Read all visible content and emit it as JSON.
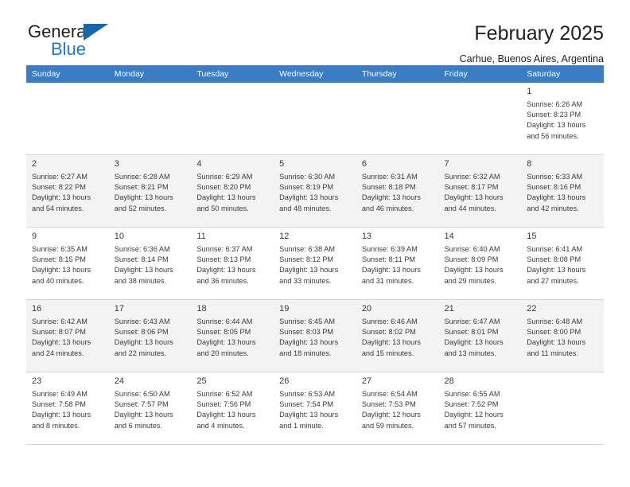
{
  "brand": {
    "name_part1": "General",
    "name_part2": "Blue",
    "triangle_color": "#1567b3",
    "blue_color": "#1f7ac4"
  },
  "header": {
    "title": "February 2025",
    "location": "Carhue, Buenos Aires, Argentina"
  },
  "theme": {
    "header_row_bg": "#3b7dc4",
    "header_row_text": "#ffffff",
    "shaded_row_bg": "#f3f3f3",
    "cell_border": "#d4d4d4",
    "text": "#3b3b3b"
  },
  "weekday_headers": [
    "Sunday",
    "Monday",
    "Tuesday",
    "Wednesday",
    "Thursday",
    "Friday",
    "Saturday"
  ],
  "weeks": [
    {
      "shaded": false,
      "days": [
        {
          "empty": true
        },
        {
          "empty": true
        },
        {
          "empty": true
        },
        {
          "empty": true
        },
        {
          "empty": true
        },
        {
          "empty": true
        },
        {
          "empty": false,
          "daynum": "1",
          "sunrise": "Sunrise: 6:26 AM",
          "sunset": "Sunset: 8:23 PM",
          "daylight_line1": "Daylight: 13 hours",
          "daylight_line2": "and 56 minutes."
        }
      ]
    },
    {
      "shaded": true,
      "days": [
        {
          "empty": false,
          "daynum": "2",
          "sunrise": "Sunrise: 6:27 AM",
          "sunset": "Sunset: 8:22 PM",
          "daylight_line1": "Daylight: 13 hours",
          "daylight_line2": "and 54 minutes."
        },
        {
          "empty": false,
          "daynum": "3",
          "sunrise": "Sunrise: 6:28 AM",
          "sunset": "Sunset: 8:21 PM",
          "daylight_line1": "Daylight: 13 hours",
          "daylight_line2": "and 52 minutes."
        },
        {
          "empty": false,
          "daynum": "4",
          "sunrise": "Sunrise: 6:29 AM",
          "sunset": "Sunset: 8:20 PM",
          "daylight_line1": "Daylight: 13 hours",
          "daylight_line2": "and 50 minutes."
        },
        {
          "empty": false,
          "daynum": "5",
          "sunrise": "Sunrise: 6:30 AM",
          "sunset": "Sunset: 8:19 PM",
          "daylight_line1": "Daylight: 13 hours",
          "daylight_line2": "and 48 minutes."
        },
        {
          "empty": false,
          "daynum": "6",
          "sunrise": "Sunrise: 6:31 AM",
          "sunset": "Sunset: 8:18 PM",
          "daylight_line1": "Daylight: 13 hours",
          "daylight_line2": "and 46 minutes."
        },
        {
          "empty": false,
          "daynum": "7",
          "sunrise": "Sunrise: 6:32 AM",
          "sunset": "Sunset: 8:17 PM",
          "daylight_line1": "Daylight: 13 hours",
          "daylight_line2": "and 44 minutes."
        },
        {
          "empty": false,
          "daynum": "8",
          "sunrise": "Sunrise: 6:33 AM",
          "sunset": "Sunset: 8:16 PM",
          "daylight_line1": "Daylight: 13 hours",
          "daylight_line2": "and 42 minutes."
        }
      ]
    },
    {
      "shaded": false,
      "days": [
        {
          "empty": false,
          "daynum": "9",
          "sunrise": "Sunrise: 6:35 AM",
          "sunset": "Sunset: 8:15 PM",
          "daylight_line1": "Daylight: 13 hours",
          "daylight_line2": "and 40 minutes."
        },
        {
          "empty": false,
          "daynum": "10",
          "sunrise": "Sunrise: 6:36 AM",
          "sunset": "Sunset: 8:14 PM",
          "daylight_line1": "Daylight: 13 hours",
          "daylight_line2": "and 38 minutes."
        },
        {
          "empty": false,
          "daynum": "11",
          "sunrise": "Sunrise: 6:37 AM",
          "sunset": "Sunset: 8:13 PM",
          "daylight_line1": "Daylight: 13 hours",
          "daylight_line2": "and 36 minutes."
        },
        {
          "empty": false,
          "daynum": "12",
          "sunrise": "Sunrise: 6:38 AM",
          "sunset": "Sunset: 8:12 PM",
          "daylight_line1": "Daylight: 13 hours",
          "daylight_line2": "and 33 minutes."
        },
        {
          "empty": false,
          "daynum": "13",
          "sunrise": "Sunrise: 6:39 AM",
          "sunset": "Sunset: 8:11 PM",
          "daylight_line1": "Daylight: 13 hours",
          "daylight_line2": "and 31 minutes."
        },
        {
          "empty": false,
          "daynum": "14",
          "sunrise": "Sunrise: 6:40 AM",
          "sunset": "Sunset: 8:09 PM",
          "daylight_line1": "Daylight: 13 hours",
          "daylight_line2": "and 29 minutes."
        },
        {
          "empty": false,
          "daynum": "15",
          "sunrise": "Sunrise: 6:41 AM",
          "sunset": "Sunset: 8:08 PM",
          "daylight_line1": "Daylight: 13 hours",
          "daylight_line2": "and 27 minutes."
        }
      ]
    },
    {
      "shaded": true,
      "days": [
        {
          "empty": false,
          "daynum": "16",
          "sunrise": "Sunrise: 6:42 AM",
          "sunset": "Sunset: 8:07 PM",
          "daylight_line1": "Daylight: 13 hours",
          "daylight_line2": "and 24 minutes."
        },
        {
          "empty": false,
          "daynum": "17",
          "sunrise": "Sunrise: 6:43 AM",
          "sunset": "Sunset: 8:06 PM",
          "daylight_line1": "Daylight: 13 hours",
          "daylight_line2": "and 22 minutes."
        },
        {
          "empty": false,
          "daynum": "18",
          "sunrise": "Sunrise: 6:44 AM",
          "sunset": "Sunset: 8:05 PM",
          "daylight_line1": "Daylight: 13 hours",
          "daylight_line2": "and 20 minutes."
        },
        {
          "empty": false,
          "daynum": "19",
          "sunrise": "Sunrise: 6:45 AM",
          "sunset": "Sunset: 8:03 PM",
          "daylight_line1": "Daylight: 13 hours",
          "daylight_line2": "and 18 minutes."
        },
        {
          "empty": false,
          "daynum": "20",
          "sunrise": "Sunrise: 6:46 AM",
          "sunset": "Sunset: 8:02 PM",
          "daylight_line1": "Daylight: 13 hours",
          "daylight_line2": "and 15 minutes."
        },
        {
          "empty": false,
          "daynum": "21",
          "sunrise": "Sunrise: 6:47 AM",
          "sunset": "Sunset: 8:01 PM",
          "daylight_line1": "Daylight: 13 hours",
          "daylight_line2": "and 13 minutes."
        },
        {
          "empty": false,
          "daynum": "22",
          "sunrise": "Sunrise: 6:48 AM",
          "sunset": "Sunset: 8:00 PM",
          "daylight_line1": "Daylight: 13 hours",
          "daylight_line2": "and 11 minutes."
        }
      ]
    },
    {
      "shaded": false,
      "days": [
        {
          "empty": false,
          "daynum": "23",
          "sunrise": "Sunrise: 6:49 AM",
          "sunset": "Sunset: 7:58 PM",
          "daylight_line1": "Daylight: 13 hours",
          "daylight_line2": "and 8 minutes."
        },
        {
          "empty": false,
          "daynum": "24",
          "sunrise": "Sunrise: 6:50 AM",
          "sunset": "Sunset: 7:57 PM",
          "daylight_line1": "Daylight: 13 hours",
          "daylight_line2": "and 6 minutes."
        },
        {
          "empty": false,
          "daynum": "25",
          "sunrise": "Sunrise: 6:52 AM",
          "sunset": "Sunset: 7:56 PM",
          "daylight_line1": "Daylight: 13 hours",
          "daylight_line2": "and 4 minutes."
        },
        {
          "empty": false,
          "daynum": "26",
          "sunrise": "Sunrise: 6:53 AM",
          "sunset": "Sunset: 7:54 PM",
          "daylight_line1": "Daylight: 13 hours",
          "daylight_line2": "and 1 minute."
        },
        {
          "empty": false,
          "daynum": "27",
          "sunrise": "Sunrise: 6:54 AM",
          "sunset": "Sunset: 7:53 PM",
          "daylight_line1": "Daylight: 12 hours",
          "daylight_line2": "and 59 minutes."
        },
        {
          "empty": false,
          "daynum": "28",
          "sunrise": "Sunrise: 6:55 AM",
          "sunset": "Sunset: 7:52 PM",
          "daylight_line1": "Daylight: 12 hours",
          "daylight_line2": "and 57 minutes."
        },
        {
          "empty": true
        }
      ]
    }
  ]
}
